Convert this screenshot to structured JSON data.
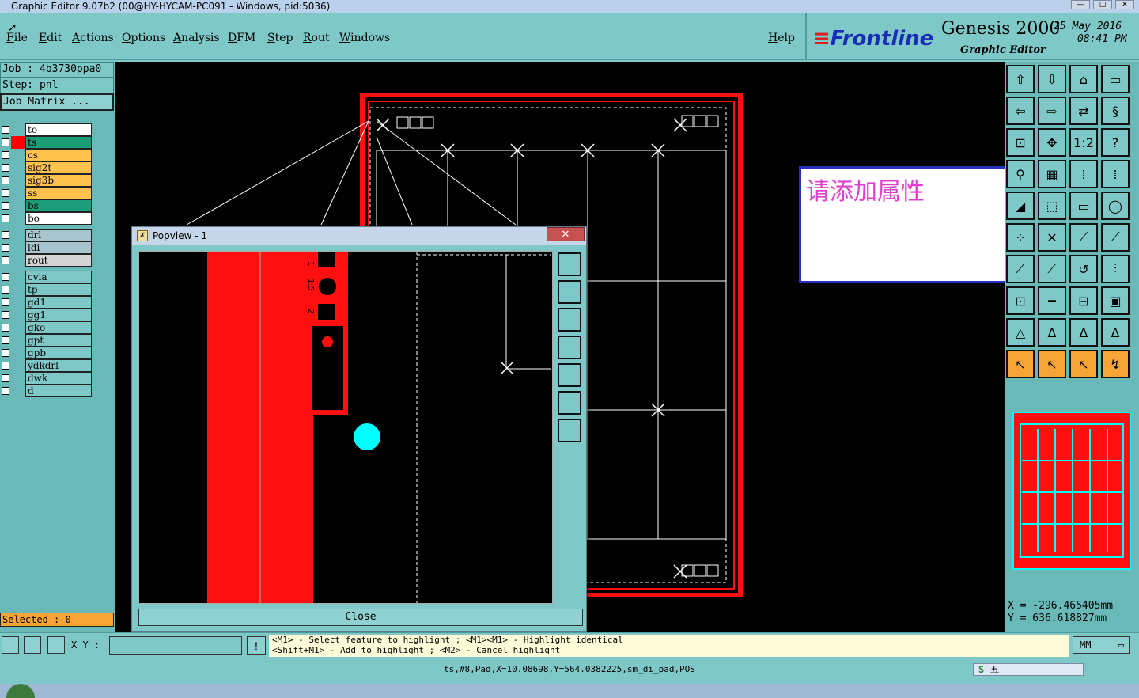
{
  "window": {
    "title": "Graphic Editor 9.07b2 (00@HY-HYCAM-PC091 - Windows, pid:5036)"
  },
  "menu": {
    "items": [
      "File",
      "Edit",
      "Actions",
      "Options",
      "Analysis",
      "DFM",
      "Step",
      "Rout",
      "Windows"
    ],
    "help": "Help"
  },
  "brand": {
    "logo": "Frontline",
    "product": "Genesis 2000",
    "subtitle": "Graphic Editor",
    "date": "25 May 2016",
    "time": "08:41 PM"
  },
  "job": {
    "job_label": "Job :  4b3730ppa0",
    "step_label": "Step: pnl",
    "matrix_button": "Job Matrix ..."
  },
  "layers": [
    {
      "name": "to",
      "color": "#ffffff",
      "box": ""
    },
    {
      "name": "ts",
      "color": "#1b9e77",
      "box": "#ff0000"
    },
    {
      "name": "cs",
      "color": "#ffc34d",
      "box": ""
    },
    {
      "name": "sig2t",
      "color": "#ffc34d",
      "box": ""
    },
    {
      "name": "sig3b",
      "color": "#ffc34d",
      "box": ""
    },
    {
      "name": "ss",
      "color": "#ffc34d",
      "box": ""
    },
    {
      "name": "bs",
      "color": "#1b9e77",
      "box": ""
    },
    {
      "name": "bo",
      "color": "#ffffff",
      "box": ""
    },
    {
      "name": "drl",
      "color": "#a8c4cc",
      "box": ""
    },
    {
      "name": "ldi",
      "color": "#a8c4cc",
      "box": ""
    },
    {
      "name": "rout",
      "color": "#d4d4d4",
      "box": ""
    },
    {
      "name": "cvia",
      "color": "#7fc8c8",
      "box": ""
    },
    {
      "name": "tp",
      "color": "#7fc8c8",
      "box": ""
    },
    {
      "name": "gd1",
      "color": "#7fc8c8",
      "box": ""
    },
    {
      "name": "gg1",
      "color": "#7fc8c8",
      "box": ""
    },
    {
      "name": "gko",
      "color": "#7fc8c8",
      "box": ""
    },
    {
      "name": "gpt",
      "color": "#7fc8c8",
      "box": ""
    },
    {
      "name": "gpb",
      "color": "#7fc8c8",
      "box": ""
    },
    {
      "name": "ydkdrl",
      "color": "#7fc8c8",
      "box": ""
    },
    {
      "name": "dwk",
      "color": "#7fc8c8",
      "box": ""
    },
    {
      "name": "d",
      "color": "#7fc8c8",
      "box": ""
    }
  ],
  "selected": "Selected : 0",
  "popview": {
    "title": "Popview - 1",
    "close_label": "Close",
    "close_x": "✕"
  },
  "note": {
    "text": "请添加属性"
  },
  "coords": {
    "x": "X = -296.465405mm",
    "y": "Y = 636.618827mm"
  },
  "units": "MM",
  "xy_label": "X Y :",
  "hint": {
    "line1": "<M1> - Select feature to highlight ; <M1><M1> - Highlight identical",
    "line2": "<Shift+M1> - Add to highlight ; <M2> - Cancel highlight"
  },
  "feature_info": "ts,#8,Pad,X=10.08698,Y=564.0382225,sm_di_pad,POS",
  "pop_labels": [
    "1",
    "1.5",
    "2"
  ],
  "ime": {
    "mode": "五"
  }
}
